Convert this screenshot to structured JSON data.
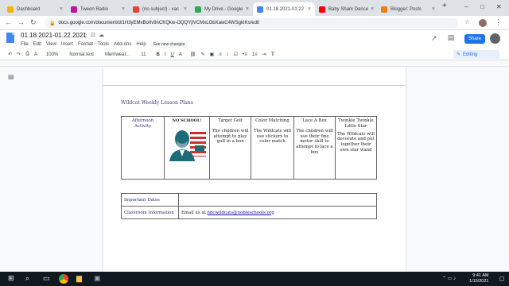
{
  "browser": {
    "tabs": [
      {
        "label": "Dashboard",
        "color": "#f4b400",
        "active": false
      },
      {
        "label": "Tween Radio",
        "color": "#b5179e",
        "active": false
      },
      {
        "label": "(no subject) - vac",
        "color": "#ea4335",
        "active": false
      },
      {
        "label": "My Drive - Google",
        "color": "#34a853",
        "active": false
      },
      {
        "label": "01.18.2021-01.22",
        "color": "#4285f4",
        "active": true
      },
      {
        "label": "Baby Shark Dance",
        "color": "#ff0000",
        "active": false
      },
      {
        "label": "Blogger: Posts",
        "color": "#f57c00",
        "active": false
      }
    ],
    "new_tab": "+",
    "window_controls": {
      "minimize": "–",
      "maximize": "□",
      "close": "✕"
    },
    "url": "docs.google.com/document/d/1H3yEMxBoIIv9nCKQkw-OQQYjlVCMxLGbXawC4WSgkIKs/edit",
    "nav": {
      "back": "←",
      "forward": "→",
      "reload": "↻"
    }
  },
  "docs": {
    "title": "01.18.2021-01.22.2021",
    "star_icon": "☆",
    "move_icon": "⊡",
    "cloud_icon": "☁",
    "menu": [
      "File",
      "Edit",
      "View",
      "Insert",
      "Format",
      "Tools",
      "Add-ons",
      "Help"
    ],
    "see_changes": "See new changes",
    "share_label": "Share",
    "toolbar": {
      "undo": "↶",
      "redo": "↷",
      "print": "⎙",
      "spell": "A",
      "zoom": "100%",
      "style": "Normal text",
      "font": "Merriweat...",
      "size": "11",
      "bold": "B",
      "italic": "I",
      "underline": "U",
      "color": "A",
      "editing": "Editing"
    }
  },
  "document": {
    "heading": "Wildcat Weekly Lesson Plans",
    "lesson_table": {
      "cells": [
        {
          "title": "Afternoon Activity",
          "body": ""
        },
        {
          "title": "NO SCHOOL!",
          "body": ""
        },
        {
          "title": "Target Golf",
          "body": "The children will attempt to play golf in a box"
        },
        {
          "title": "Color Matching",
          "body": "The Wildcats will use stickers to color match"
        },
        {
          "title": "Lace A Box",
          "body": "The children will use their fine motor skill to attempt to lace a box"
        },
        {
          "title": "Twinkle Twinkle Little Star",
          "body": "The Wildcats will decorate and put together their own star wand"
        }
      ]
    },
    "info_table": [
      {
        "label": "Important Dates",
        "value": "",
        "email": ""
      },
      {
        "label": "Classroom Information",
        "value": "Email us at ",
        "email": "ndcwildcats@nobleschools.org"
      }
    ]
  },
  "taskbar": {
    "time": "9:41 AM",
    "date": "1/15/2021"
  }
}
